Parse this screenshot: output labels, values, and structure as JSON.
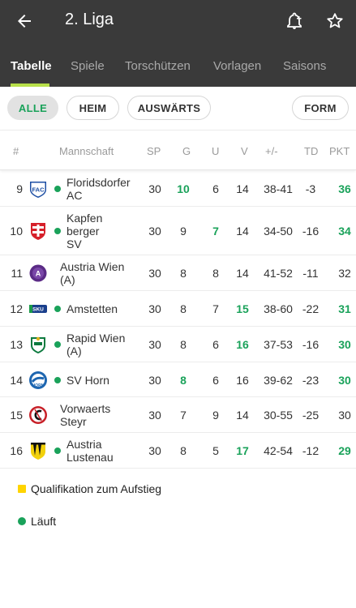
{
  "header": {
    "title": "2. Liga",
    "back_icon": "arrow-left-icon",
    "bell_icon": "bell-plus-icon",
    "star_icon": "star-outline-icon"
  },
  "tabs": [
    {
      "label": "Tabelle",
      "active": true
    },
    {
      "label": "Spiele"
    },
    {
      "label": "Torschützen"
    },
    {
      "label": "Vorlagen"
    },
    {
      "label": "Saisons"
    }
  ],
  "filters": {
    "all": "ALLE",
    "home": "HEIM",
    "away": "AUSWÄRTS",
    "form": "FORM"
  },
  "columns": {
    "rank": "#",
    "team": "Mannschaft",
    "sp": "SP",
    "g": "G",
    "u": "U",
    "v": "V",
    "diff": "+/-",
    "td": "TD",
    "pkt": "PKT"
  },
  "rows": [
    {
      "rank": "9",
      "team": "Floridsdorfer AC",
      "team_lines": [
        "Floridsdorfer",
        "AC"
      ],
      "sp": "30",
      "g": "10",
      "u": "6",
      "v": "14",
      "diff": "38-41",
      "td": "-3",
      "pkt": "36",
      "hl": "g",
      "hl_pkt": true,
      "live": true
    },
    {
      "rank": "10",
      "team": "Kapfenberger SV",
      "team_lines": [
        "Kapfen",
        "berger",
        "SV"
      ],
      "sp": "30",
      "g": "9",
      "u": "7",
      "v": "14",
      "diff": "34-50",
      "td": "-16",
      "pkt": "34",
      "hl": "u",
      "hl_pkt": true,
      "live": true
    },
    {
      "rank": "11",
      "team": "Austria Wien (A)",
      "team_lines": [
        "Austria Wien",
        "(A)"
      ],
      "sp": "30",
      "g": "8",
      "u": "8",
      "v": "14",
      "diff": "41-52",
      "td": "-11",
      "pkt": "32",
      "hl": "",
      "hl_pkt": false,
      "live": false
    },
    {
      "rank": "12",
      "team": "Amstetten",
      "team_lines": [
        "Amstetten"
      ],
      "sp": "30",
      "g": "8",
      "u": "7",
      "v": "15",
      "diff": "38-60",
      "td": "-22",
      "pkt": "31",
      "hl": "v",
      "hl_pkt": true,
      "live": true
    },
    {
      "rank": "13",
      "team": "Rapid Wien (A)",
      "team_lines": [
        "Rapid Wien",
        "(A)"
      ],
      "sp": "30",
      "g": "8",
      "u": "6",
      "v": "16",
      "diff": "37-53",
      "td": "-16",
      "pkt": "30",
      "hl": "v",
      "hl_pkt": true,
      "live": true
    },
    {
      "rank": "14",
      "team": "SV Horn",
      "team_lines": [
        "SV Horn"
      ],
      "sp": "30",
      "g": "8",
      "u": "6",
      "v": "16",
      "diff": "39-62",
      "td": "-23",
      "pkt": "30",
      "hl": "g",
      "hl_pkt": true,
      "live": true
    },
    {
      "rank": "15",
      "team": "Vorwaerts Steyr",
      "team_lines": [
        "Vorwaerts",
        "Steyr"
      ],
      "sp": "30",
      "g": "7",
      "u": "9",
      "v": "14",
      "diff": "30-55",
      "td": "-25",
      "pkt": "30",
      "hl": "",
      "hl_pkt": false,
      "live": false
    },
    {
      "rank": "16",
      "team": "Austria Lustenau",
      "team_lines": [
        "Austria",
        "Lustenau"
      ],
      "sp": "30",
      "g": "8",
      "u": "5",
      "v": "17",
      "diff": "42-54",
      "td": "-12",
      "pkt": "29",
      "hl": "v",
      "hl_pkt": true,
      "live": true
    }
  ],
  "legend": {
    "promotion": "Qualifikation zum Aufstieg",
    "live": "Läuft"
  },
  "colors": {
    "appbar": "#3a3a3a",
    "accent_green": "#1aa25a",
    "tab_indicator": "#b8e04a",
    "promotion_yellow": "#ffd400"
  }
}
